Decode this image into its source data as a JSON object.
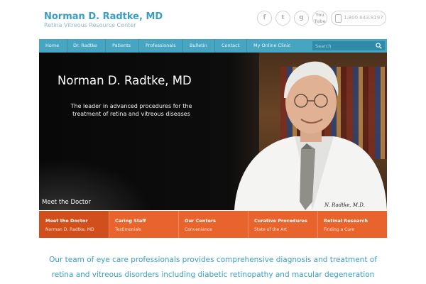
{
  "header": {
    "title": "Norman D. Radtke, MD",
    "subtitle": "Retina Vitreous Resource Center"
  },
  "social": {
    "facebook": "f",
    "twitter": "t",
    "google": "g",
    "youtube_line1": "You",
    "youtube_line2": "Tube",
    "phone": "1.800.643.8197"
  },
  "nav": {
    "items": [
      "Home",
      "Dr. Radtke",
      "Patients",
      "Professionals",
      "Bulletin",
      "Contact",
      "My Online Clinic"
    ],
    "search_placeholder": "Search"
  },
  "hero": {
    "name": "Norman D. Radtke, MD",
    "tagline": "The leader in advanced procedures for the treatment of retina and vitreous diseases",
    "caption": "Meet the Doctor",
    "signature": "N. Radtke, M.D."
  },
  "tabs": [
    {
      "title": "Meet the Doctor",
      "subtitle": "Norman D. Radtke, MD",
      "active": true
    },
    {
      "title": "Caring Staff",
      "subtitle": "Testimonials",
      "active": false
    },
    {
      "title": "Our Centers",
      "subtitle": "Convenience",
      "active": false
    },
    {
      "title": "Curative Procedures",
      "subtitle": "State of the Art",
      "active": false
    },
    {
      "title": "Retinal Research",
      "subtitle": "Finding a Cure",
      "active": false
    }
  ],
  "intro": {
    "line1": "Our team of eye care professionals provides comprehensive diagnosis and treatment of",
    "line2": "retina and vitreous disorders including diabetic retinopathy and macular degeneration"
  },
  "colors": {
    "brand_blue": "#3a9fc0",
    "nav_bar": "#47a5c2",
    "tab_orange": "#e8642c",
    "tab_active": "#d14f1c"
  },
  "icons": [
    "facebook-icon",
    "twitter-icon",
    "google-plus-icon",
    "youtube-icon",
    "phone-icon",
    "search-icon"
  ]
}
